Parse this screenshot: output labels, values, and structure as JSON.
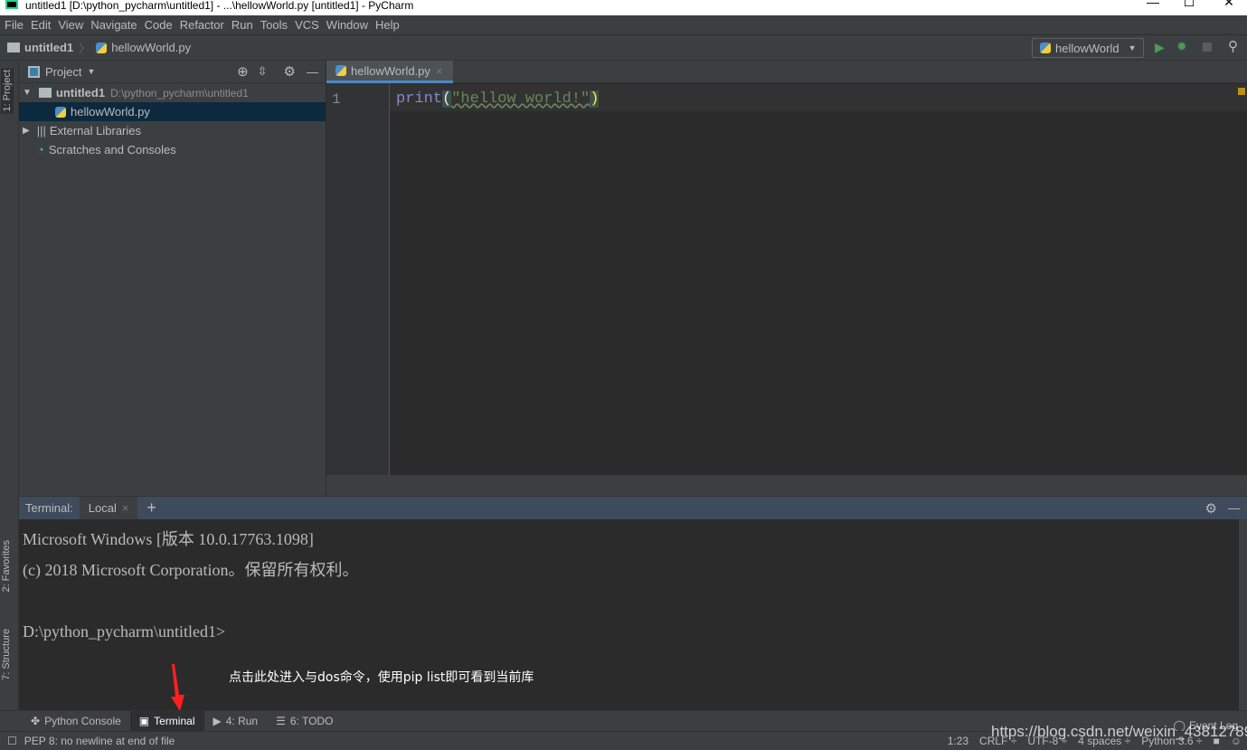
{
  "window": {
    "title": "untitled1 [D:\\python_pycharm\\untitled1] - ...\\hellowWorld.py [untitled1] - PyCharm",
    "minimize": "—",
    "maximize": "☐",
    "close": "✕"
  },
  "menu": [
    "File",
    "Edit",
    "View",
    "Navigate",
    "Code",
    "Refactor",
    "Run",
    "Tools",
    "VCS",
    "Window",
    "Help"
  ],
  "breadcrumb": {
    "project": "untitled1",
    "file": "hellowWorld.py"
  },
  "toolbar": {
    "run_config": "hellowWorld",
    "run_icon": "play-icon",
    "debug_icon": "bug-icon",
    "stop_icon": "stop-icon",
    "search_icon": "search-icon"
  },
  "left_stripe": {
    "project": "1: Project",
    "favorites": "2: Favorites",
    "structure": "7: Structure"
  },
  "project_panel": {
    "title": "Project",
    "tree": [
      {
        "label": "untitled1",
        "path": "D:\\python_pycharm\\untitled1"
      },
      {
        "label": "hellowWorld.py"
      },
      {
        "label": "External Libraries"
      },
      {
        "label": "Scratches and Consoles"
      }
    ]
  },
  "editor": {
    "tab": "hellowWorld.py",
    "line_number": "1",
    "code": {
      "fn": "print",
      "open": "(",
      "str": "\"hellow world!\"",
      "close": ")"
    }
  },
  "terminal": {
    "label": "Terminal:",
    "tab": "Local",
    "add": "+",
    "lines": [
      "Microsoft Windows [版本 10.0.17763.1098]",
      "(c) 2018 Microsoft Corporation。保留所有权利。",
      "",
      "D:\\python_pycharm\\untitled1>"
    ],
    "annotation": "点击此处进入与dos命令，使用pip list即可看到当前库"
  },
  "bottom_tools": [
    "Python Console",
    "Terminal",
    "4: Run",
    "6: TODO"
  ],
  "event_log": "Event Log",
  "status": {
    "message": "PEP 8: no newline at end of file",
    "position": "1:23",
    "line_sep": "CRLF ÷",
    "encoding": "UTF-8 ÷",
    "indent": "4 spaces ÷",
    "interpreter": "Python 3.6 ÷"
  },
  "watermark": "https://blog.csdn.net/weixin_43812789",
  "colors": {
    "accent": "#4a88c7",
    "annotation_arrow": "#ff2020",
    "run": "#499c54"
  }
}
